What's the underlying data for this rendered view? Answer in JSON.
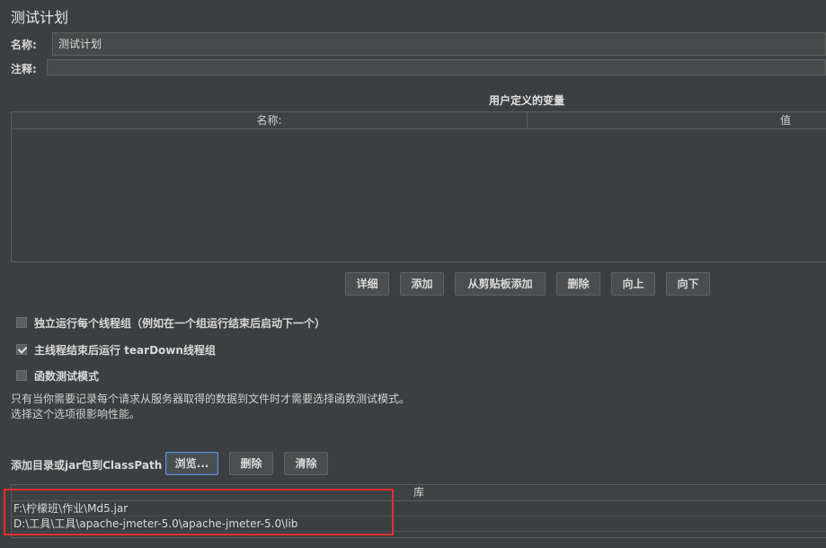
{
  "page_title": "测试计划",
  "name_field": {
    "label": "名称:",
    "value": "测试计划"
  },
  "comment_field": {
    "label": "注释:",
    "value": ""
  },
  "user_vars": {
    "title": "用户定义的变量",
    "columns": [
      "名称:",
      "值"
    ]
  },
  "var_buttons": {
    "detail": "详细",
    "add": "添加",
    "add_clipboard": "从剪贴板添加",
    "delete": "删除",
    "up": "向上",
    "down": "向下"
  },
  "options": [
    {
      "label": "独立运行每个线程组（例如在一个组运行结束后启动下一个）",
      "checked": false
    },
    {
      "label": "主线程结束后运行 tearDown线程组",
      "checked": true
    },
    {
      "label": "函数测试模式",
      "checked": false
    }
  ],
  "note": {
    "line1": "只有当你需要记录每个请求从服务器取得的数据到文件时才需要选择函数测试模式。",
    "line2": "选择这个选项很影响性能。"
  },
  "classpath": {
    "label": "添加目录或jar包到ClassPath",
    "browse": "浏览...",
    "delete": "删除",
    "clear": "清除",
    "column": "库",
    "rows": [
      "F:\\柠檬班\\作业\\Md5.jar",
      "D:\\工具\\工具\\apache-jmeter-5.0\\apache-jmeter-5.0\\lib"
    ]
  },
  "colors": {
    "background": "#3c3f41",
    "highlight": "#e03030",
    "focus": "#6a8fc0"
  }
}
